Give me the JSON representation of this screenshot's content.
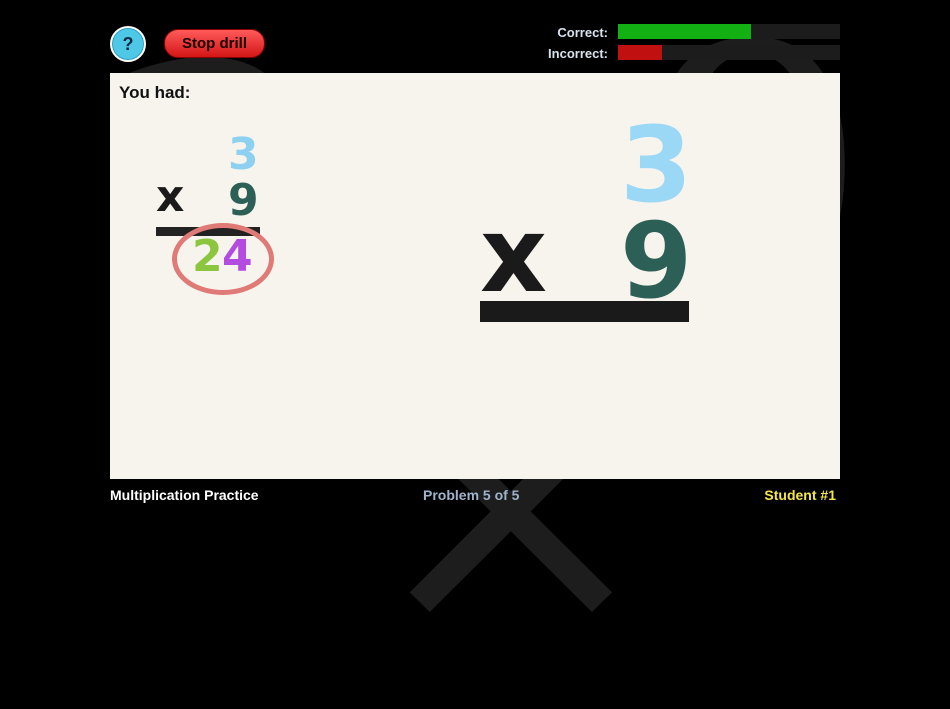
{
  "controls": {
    "help_label": "?",
    "stop_label": "Stop drill"
  },
  "score": {
    "correct_label": "Correct:",
    "incorrect_label": "Incorrect:",
    "correct_fraction": 0.6,
    "incorrect_fraction": 0.2,
    "correct_color": "#13b013",
    "incorrect_color": "#c01010"
  },
  "feedback": {
    "heading": "You had:",
    "top": "3",
    "bottom": "9",
    "operator": "x",
    "answer_tens": "2",
    "answer_ones": "4"
  },
  "problem": {
    "top": "3",
    "bottom": "9",
    "operator": "x"
  },
  "footer": {
    "app_name": "Multiplication Practice",
    "progress": "Problem 5 of 5",
    "student": "Student #1"
  }
}
